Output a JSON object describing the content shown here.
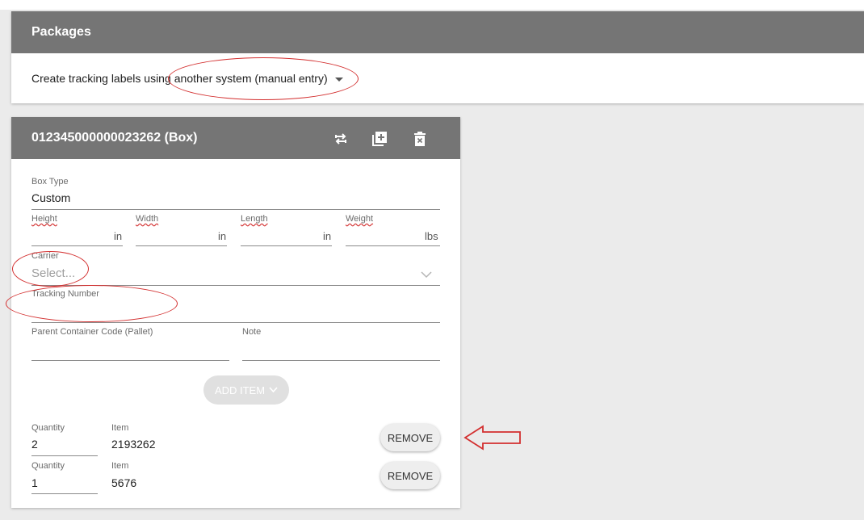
{
  "packages": {
    "title": "Packages",
    "label_prefix": "Create tracking labels using",
    "method_value": "another system (manual entry)"
  },
  "box": {
    "title": "012345000000023262 (Box)",
    "icons": [
      "swap-icon",
      "add-box-icon",
      "delete-icon"
    ],
    "box_type": {
      "label": "Box Type",
      "value": "Custom"
    },
    "dimensions": [
      {
        "label": "Height",
        "unit": "in"
      },
      {
        "label": "Width",
        "unit": "in"
      },
      {
        "label": "Length",
        "unit": "in"
      },
      {
        "label": "Weight",
        "unit": "lbs"
      }
    ],
    "carrier": {
      "label": "Carrier",
      "placeholder": "Select..."
    },
    "tracking": {
      "label": "Tracking Number"
    },
    "parent_container": {
      "label": "Parent Container Code (Pallet)"
    },
    "note": {
      "label": "Note"
    },
    "add_item_label": "ADD ITEM",
    "items": [
      {
        "quantity_label": "Quantity",
        "quantity": "2",
        "item_label": "Item",
        "item": "2193262",
        "remove_label": "REMOVE"
      },
      {
        "quantity_label": "Quantity",
        "quantity": "1",
        "item_label": "Item",
        "item": "5676",
        "remove_label": "REMOVE"
      }
    ]
  },
  "colors": {
    "header": "#757575",
    "annotation": "#d32f2f",
    "background": "#ebebeb"
  }
}
